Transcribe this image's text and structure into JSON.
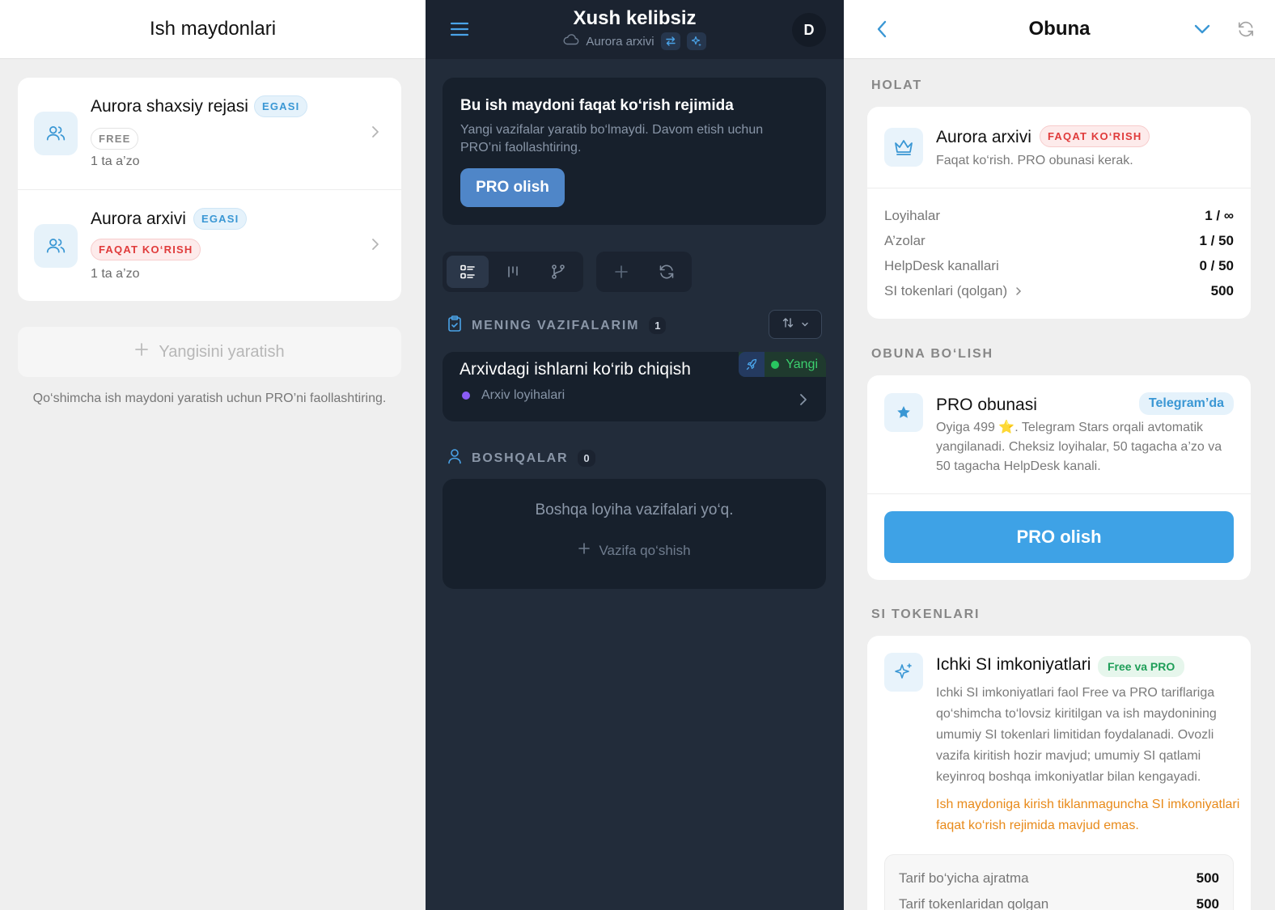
{
  "left": {
    "title": "Ish maydonlari",
    "workspaces": [
      {
        "name": "Aurora shaxsiy rejasi",
        "role_badge": "EGASI",
        "plan_badge": "FREE",
        "members": "1 ta a’zo"
      },
      {
        "name": "Aurora arxivi",
        "role_badge": "EGASI",
        "plan_badge": "FAQAT KO‘RISH",
        "members": "1 ta a’zo"
      }
    ],
    "create_label": "Yangisini yaratish",
    "create_hint": "Qo‘shimcha ish maydoni yaratish uchun PRO’ni faollashtiring."
  },
  "middle": {
    "title": "Xush kelibsiz",
    "subtitle": "Aurora arxivi",
    "avatar_letter": "D",
    "readonly_banner": {
      "title": "Bu ish maydoni faqat ko‘rish rejimida",
      "text": "Yangi vazifalar yaratib bo‘lmaydi. Davom etish uchun PRO’ni faollashtiring.",
      "button": "PRO olish"
    },
    "my_tasks": {
      "heading": "MENING VAZIFALARIM",
      "count": "1",
      "tasks": [
        {
          "title": "Arxivdagi ishlarni ko‘rib chiqish",
          "project": "Arxiv loyihalari",
          "status": "Yangi"
        }
      ]
    },
    "others": {
      "heading": "BOSHQALAR",
      "count": "0",
      "empty": "Boshqa loyiha vazifalari yo‘q.",
      "add_label": "Vazifa qo‘shish"
    }
  },
  "right": {
    "title": "Obuna",
    "status_section": "HOLAT",
    "status_card": {
      "name": "Aurora arxivi",
      "badge": "FAQAT KO‘RISH",
      "desc": "Faqat ko‘rish. PRO obunasi kerak.",
      "limits": [
        {
          "label": "Loyihalar",
          "value": "1 / ∞"
        },
        {
          "label": "A’zolar",
          "value": "1 / 50"
        },
        {
          "label": "HelpDesk kanallari",
          "value": "0 / 50"
        },
        {
          "label": "SI tokenlari (qolgan)",
          "value": "500"
        }
      ]
    },
    "subscribe_section": "OBUNA BO‘LISH",
    "pro_card": {
      "name": "PRO obunasi",
      "badge": "Telegram’da",
      "desc": "Oyiga 499 ⭐. Telegram Stars orqali avtomatik yangilanadi. Cheksiz loyihalar, 50 tagacha a’zo va 50 tagacha HelpDesk kanali.",
      "button": "PRO olish"
    },
    "tokens_section": "SI TOKENLARI",
    "ai_card": {
      "name": "Ichki SI imkoniyatlari",
      "badge": "Free va PRO",
      "desc": "Ichki SI imkoniyatlari faol Free va PRO tariflariga qo‘shimcha to‘lovsiz kiritilgan va ish maydonining umumiy SI tokenlari limitidan foydalanadi. Ovozli vazifa kiritish hozir mavjud; umumiy SI qatlami keyinroq boshqa imkoniyatlar bilan kengayadi.",
      "warning": "Ish maydoniga kirish tiklanmaguncha SI imkoniyatlari faqat ko‘rish rejimida mavjud emas.",
      "rows": [
        {
          "label": "Tarif bo‘yicha ajratma",
          "value": "500"
        },
        {
          "label": "Tarif tokenlaridan qolgan",
          "value": "500"
        }
      ]
    }
  },
  "colors": {
    "accent_blue": "#3ea2e6",
    "dark_bg": "#222c3a",
    "readonly_red": "#e03b3b",
    "status_green": "#28c560",
    "warning_orange": "#e88a1a"
  }
}
